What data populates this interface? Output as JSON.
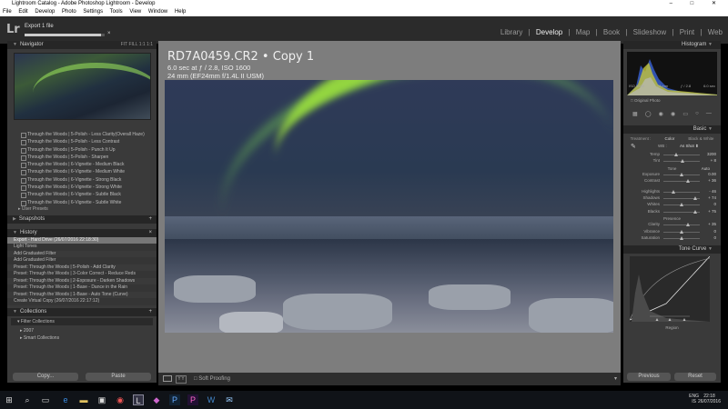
{
  "window": {
    "title": "Lightroom Catalog - Adobe Photoshop Lightroom - Develop",
    "controls": "– □ ✕"
  },
  "menu": [
    "File",
    "Edit",
    "Develop",
    "Photo",
    "Settings",
    "Tools",
    "View",
    "Window",
    "Help"
  ],
  "identity": {
    "logo": "Lr",
    "task": "Export 1 file",
    "progress_fraction": 0.95,
    "close": "×"
  },
  "modules": {
    "items": [
      "Library",
      "Develop",
      "Map",
      "Book",
      "Slideshow",
      "Print",
      "Web"
    ],
    "separator": "|",
    "active": "Develop"
  },
  "navigator": {
    "title": "Navigator",
    "zoom_options": [
      "FIT",
      "FILL",
      "1:1",
      "1:1"
    ]
  },
  "presets": {
    "items": [
      "Through the Woods | 5-Polish - Less Clarity(Overall Haze)",
      "Through the Woods | 5-Polish - Less Contrast",
      "Through the Woods | 5-Polish - Punch It Up",
      "Through the Woods | 5-Polish - Sharpen",
      "Through the Woods | 6-Vignette - Medium Black",
      "Through the Woods | 6-Vignette - Medium White",
      "Through the Woods | 6-Vignette - Strong Black",
      "Through the Woods | 6-Vignette - Strong White",
      "Through the Woods | 6-Vignette - Subtle Black",
      "Through the Woods | 6-Vignette - Subtle White"
    ],
    "user_presets": "User Presets"
  },
  "snapshots": {
    "title": "Snapshots",
    "add": "+"
  },
  "history": {
    "title": "History",
    "close": "×",
    "items": [
      "Export - Hard Drive (26/07/2016 22:18:30)",
      "Light Tones",
      "Add Graduated Filter",
      "Add Graduated Filter",
      "Preset: Through the Woods | 5-Polish - Add Clarity",
      "Preset: Through the Woods | 3-Color Correct - Reduce Reds",
      "Preset: Through the Woods | 2-Exposure - Darken Shadows",
      "Preset: Through the Woods | 1-Base - Dance in the Rain",
      "Preset: Through the Woods | 1-Base - Auto Tone (Curve)",
      "Create Virtual Copy (26/07/2016 22:17:12)"
    ]
  },
  "collections": {
    "title": "Collections",
    "add": "+",
    "items": [
      "Filter Collections",
      "2007",
      "Smart Collections"
    ]
  },
  "left_buttons": {
    "copy": "Copy...",
    "paste": "Paste"
  },
  "photo_info": {
    "filename": "RD7A0459.CR2 • Copy 1",
    "exposure": "6.0 sec at ƒ / 2.8, ISO 1600",
    "lens": "24 mm (EF24mm f/1.4L II USM)"
  },
  "toolbar": {
    "softproof": "Soft Proofing",
    "compare_label": "YY"
  },
  "histogram": {
    "title": "Histogram",
    "info": [
      "ISO 1600",
      "24 mm",
      "ƒ / 2.8",
      "6.0 sec"
    ],
    "original": "Original Photo"
  },
  "basic": {
    "title": "Basic",
    "tabs": [
      "Treatment :",
      "Color",
      "Black & White"
    ],
    "wb_label": "WB :",
    "wb_value": "As Shot ⬍",
    "sliders_wb": [
      {
        "label": "Temp",
        "value": "3200",
        "pos": 0.35
      },
      {
        "label": "Tint",
        "value": "+ 8",
        "pos": 0.52
      }
    ],
    "tone_label": "Tone",
    "tone_auto": "Auto",
    "sliders_tone": [
      {
        "label": "Exposure",
        "value": "0.00",
        "pos": 0.5
      },
      {
        "label": "Contrast",
        "value": "+ 36",
        "pos": 0.68
      }
    ],
    "sliders_tone2": [
      {
        "label": "Highlights",
        "value": "- 46",
        "pos": 0.27
      },
      {
        "label": "Shadows",
        "value": "+ 74",
        "pos": 0.87
      },
      {
        "label": "Whites",
        "value": "0",
        "pos": 0.5
      },
      {
        "label": "Blacks",
        "value": "+ 75",
        "pos": 0.88
      }
    ],
    "presence_label": "Presence",
    "sliders_presence": [
      {
        "label": "Clarity",
        "value": "+ 35",
        "pos": 0.68
      },
      {
        "label": "Vibrance",
        "value": "0",
        "pos": 0.5
      },
      {
        "label": "Saturation",
        "value": "0",
        "pos": 0.5
      }
    ]
  },
  "tone_curve": {
    "title": "Tone Curve",
    "region": "Region"
  },
  "right_buttons": {
    "previous": "Previous",
    "reset": "Reset"
  },
  "taskbar": {
    "lang": [
      "ENG",
      "IS"
    ],
    "time": "22:18",
    "date": "26/07/2016"
  },
  "colors": {
    "accent_aurora": "#a6e640",
    "panel": "#3a3a3a",
    "center_bg": "#7d7d7d"
  }
}
